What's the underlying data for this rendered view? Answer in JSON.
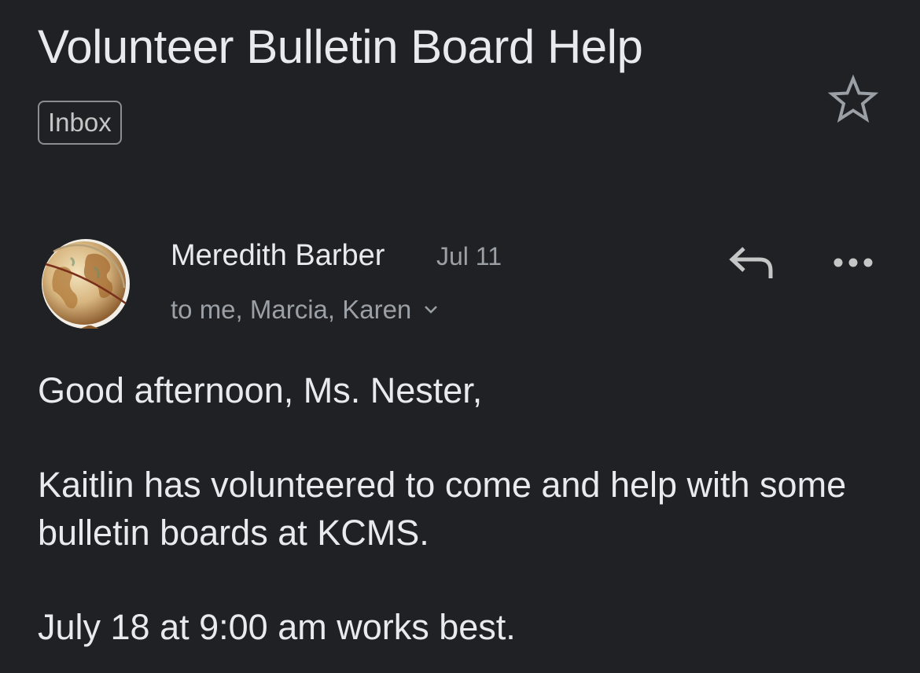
{
  "email": {
    "subject": "Volunteer Bulletin Board Help",
    "label": "Inbox",
    "starred": false,
    "sender": {
      "name": "Meredith Barber",
      "date": "Jul 11",
      "recipients": "to me, Marcia, Karen"
    },
    "body": {
      "greeting": "Good afternoon, Ms. Nester,",
      "paragraph1": "Kaitlin has volunteered to come and help with some bulletin boards at KCMS.",
      "paragraph2": "July 18 at 9:00 am works best."
    }
  },
  "icons": {
    "star": "star-outline-icon",
    "reply": "reply-icon",
    "more": "more-horizontal-icon",
    "expand": "chevron-down-icon",
    "avatar": "globe-avatar"
  },
  "colors": {
    "background": "#202124",
    "primary_text": "#e8eaed",
    "secondary_text": "#9aa0a6"
  }
}
